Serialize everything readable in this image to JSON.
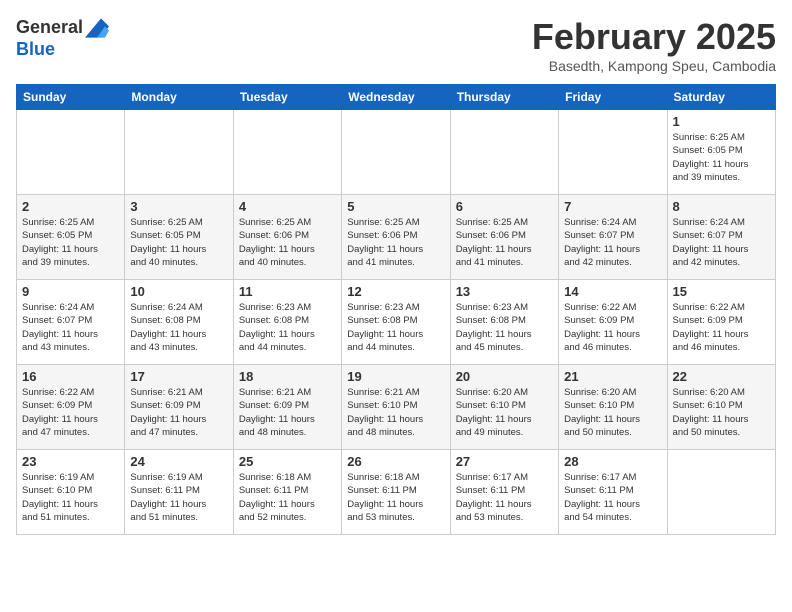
{
  "header": {
    "logo_line1": "General",
    "logo_line2": "Blue",
    "month_title": "February 2025",
    "subtitle": "Basedth, Kampong Speu, Cambodia"
  },
  "days_of_week": [
    "Sunday",
    "Monday",
    "Tuesday",
    "Wednesday",
    "Thursday",
    "Friday",
    "Saturday"
  ],
  "weeks": [
    [
      {
        "num": "",
        "info": ""
      },
      {
        "num": "",
        "info": ""
      },
      {
        "num": "",
        "info": ""
      },
      {
        "num": "",
        "info": ""
      },
      {
        "num": "",
        "info": ""
      },
      {
        "num": "",
        "info": ""
      },
      {
        "num": "1",
        "info": "Sunrise: 6:25 AM\nSunset: 6:05 PM\nDaylight: 11 hours\nand 39 minutes."
      }
    ],
    [
      {
        "num": "2",
        "info": "Sunrise: 6:25 AM\nSunset: 6:05 PM\nDaylight: 11 hours\nand 39 minutes."
      },
      {
        "num": "3",
        "info": "Sunrise: 6:25 AM\nSunset: 6:05 PM\nDaylight: 11 hours\nand 40 minutes."
      },
      {
        "num": "4",
        "info": "Sunrise: 6:25 AM\nSunset: 6:06 PM\nDaylight: 11 hours\nand 40 minutes."
      },
      {
        "num": "5",
        "info": "Sunrise: 6:25 AM\nSunset: 6:06 PM\nDaylight: 11 hours\nand 41 minutes."
      },
      {
        "num": "6",
        "info": "Sunrise: 6:25 AM\nSunset: 6:06 PM\nDaylight: 11 hours\nand 41 minutes."
      },
      {
        "num": "7",
        "info": "Sunrise: 6:24 AM\nSunset: 6:07 PM\nDaylight: 11 hours\nand 42 minutes."
      },
      {
        "num": "8",
        "info": "Sunrise: 6:24 AM\nSunset: 6:07 PM\nDaylight: 11 hours\nand 42 minutes."
      }
    ],
    [
      {
        "num": "9",
        "info": "Sunrise: 6:24 AM\nSunset: 6:07 PM\nDaylight: 11 hours\nand 43 minutes."
      },
      {
        "num": "10",
        "info": "Sunrise: 6:24 AM\nSunset: 6:08 PM\nDaylight: 11 hours\nand 43 minutes."
      },
      {
        "num": "11",
        "info": "Sunrise: 6:23 AM\nSunset: 6:08 PM\nDaylight: 11 hours\nand 44 minutes."
      },
      {
        "num": "12",
        "info": "Sunrise: 6:23 AM\nSunset: 6:08 PM\nDaylight: 11 hours\nand 44 minutes."
      },
      {
        "num": "13",
        "info": "Sunrise: 6:23 AM\nSunset: 6:08 PM\nDaylight: 11 hours\nand 45 minutes."
      },
      {
        "num": "14",
        "info": "Sunrise: 6:22 AM\nSunset: 6:09 PM\nDaylight: 11 hours\nand 46 minutes."
      },
      {
        "num": "15",
        "info": "Sunrise: 6:22 AM\nSunset: 6:09 PM\nDaylight: 11 hours\nand 46 minutes."
      }
    ],
    [
      {
        "num": "16",
        "info": "Sunrise: 6:22 AM\nSunset: 6:09 PM\nDaylight: 11 hours\nand 47 minutes."
      },
      {
        "num": "17",
        "info": "Sunrise: 6:21 AM\nSunset: 6:09 PM\nDaylight: 11 hours\nand 47 minutes."
      },
      {
        "num": "18",
        "info": "Sunrise: 6:21 AM\nSunset: 6:09 PM\nDaylight: 11 hours\nand 48 minutes."
      },
      {
        "num": "19",
        "info": "Sunrise: 6:21 AM\nSunset: 6:10 PM\nDaylight: 11 hours\nand 48 minutes."
      },
      {
        "num": "20",
        "info": "Sunrise: 6:20 AM\nSunset: 6:10 PM\nDaylight: 11 hours\nand 49 minutes."
      },
      {
        "num": "21",
        "info": "Sunrise: 6:20 AM\nSunset: 6:10 PM\nDaylight: 11 hours\nand 50 minutes."
      },
      {
        "num": "22",
        "info": "Sunrise: 6:20 AM\nSunset: 6:10 PM\nDaylight: 11 hours\nand 50 minutes."
      }
    ],
    [
      {
        "num": "23",
        "info": "Sunrise: 6:19 AM\nSunset: 6:10 PM\nDaylight: 11 hours\nand 51 minutes."
      },
      {
        "num": "24",
        "info": "Sunrise: 6:19 AM\nSunset: 6:11 PM\nDaylight: 11 hours\nand 51 minutes."
      },
      {
        "num": "25",
        "info": "Sunrise: 6:18 AM\nSunset: 6:11 PM\nDaylight: 11 hours\nand 52 minutes."
      },
      {
        "num": "26",
        "info": "Sunrise: 6:18 AM\nSunset: 6:11 PM\nDaylight: 11 hours\nand 53 minutes."
      },
      {
        "num": "27",
        "info": "Sunrise: 6:17 AM\nSunset: 6:11 PM\nDaylight: 11 hours\nand 53 minutes."
      },
      {
        "num": "28",
        "info": "Sunrise: 6:17 AM\nSunset: 6:11 PM\nDaylight: 11 hours\nand 54 minutes."
      },
      {
        "num": "",
        "info": ""
      }
    ]
  ]
}
